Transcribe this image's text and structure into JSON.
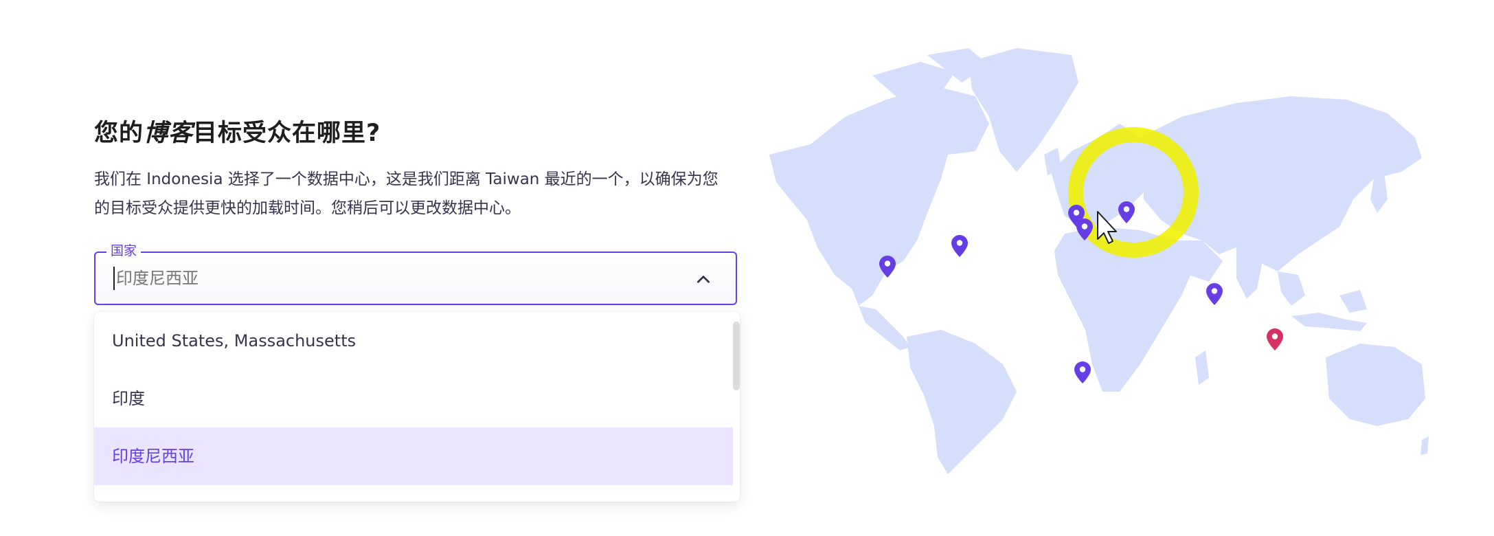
{
  "heading": {
    "prefix": "您的",
    "emphasis": "博客",
    "suffix": "目标受众在哪里?"
  },
  "description": "我们在 Indonesia 选择了一个数据中心，这是我们距离 Taiwan 最近的一个，以确保为您的目标受众提供更快的加载时间。您稍后可以更改数据中心。",
  "country_field": {
    "label": "国家",
    "value": "",
    "placeholder": "印度尼西亚"
  },
  "dropdown": {
    "options": [
      {
        "label": "United States, Massachusetts",
        "selected": false
      },
      {
        "label": "印度",
        "selected": false
      },
      {
        "label": "印度尼西亚",
        "selected": true
      }
    ]
  },
  "icons": {
    "collapse": "chevron-up-icon",
    "pin": "map-pin-icon",
    "cursor": "mouse-pointer-icon"
  },
  "colors": {
    "accent": "#673de6",
    "map_land": "#d5defa",
    "pin_default": "#673de6",
    "pin_selected": "#d63163",
    "highlight_ring": "#f0f000",
    "option_selected_bg": "#ebe4ff"
  }
}
